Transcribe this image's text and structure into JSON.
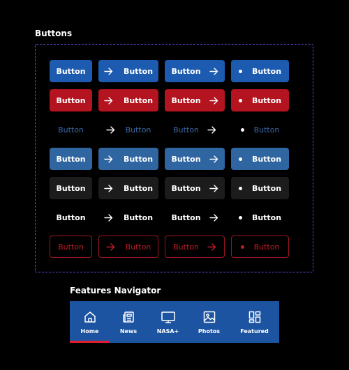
{
  "sections": {
    "buttons_title": "Buttons",
    "navigator_title": "Features Navigator"
  },
  "button_label": "Button",
  "button_rows": [
    {
      "variant": "primary",
      "bg": "#1c5bb0",
      "text_color": "#ffffff"
    },
    {
      "variant": "danger",
      "bg": "#b3141f",
      "text_color": "#ffffff"
    },
    {
      "variant": "ghost",
      "bg": "transparent",
      "text_color": "#3c6aa8"
    },
    {
      "variant": "tonal",
      "bg": "#2f65a0",
      "text_color": "#ffffff"
    },
    {
      "variant": "dark",
      "bg": "#1c1c1c",
      "text_color": "#ffffff"
    },
    {
      "variant": "plain",
      "bg": "transparent",
      "text_color": "#ffffff"
    },
    {
      "variant": "outline-red",
      "bg": "transparent",
      "text_color": "#c01c26",
      "border": "#9d1620"
    }
  ],
  "button_columns": [
    {
      "icon": "none"
    },
    {
      "icon": "arrow-right-icon",
      "icon_position": "leading"
    },
    {
      "icon": "arrow-right-icon",
      "icon_position": "trailing"
    },
    {
      "icon": "dot-icon",
      "icon_position": "leading"
    }
  ],
  "navigator": {
    "accent": "#1c54a2",
    "active_indicator": "#e01e2d",
    "active_index": 0,
    "items": [
      {
        "label": "Home",
        "icon": "home-icon"
      },
      {
        "label": "News",
        "icon": "newspaper-icon"
      },
      {
        "label": "NASA+",
        "icon": "monitor-icon"
      },
      {
        "label": "Photos",
        "icon": "image-icon"
      },
      {
        "label": "Featured",
        "icon": "grid-icon"
      }
    ]
  }
}
